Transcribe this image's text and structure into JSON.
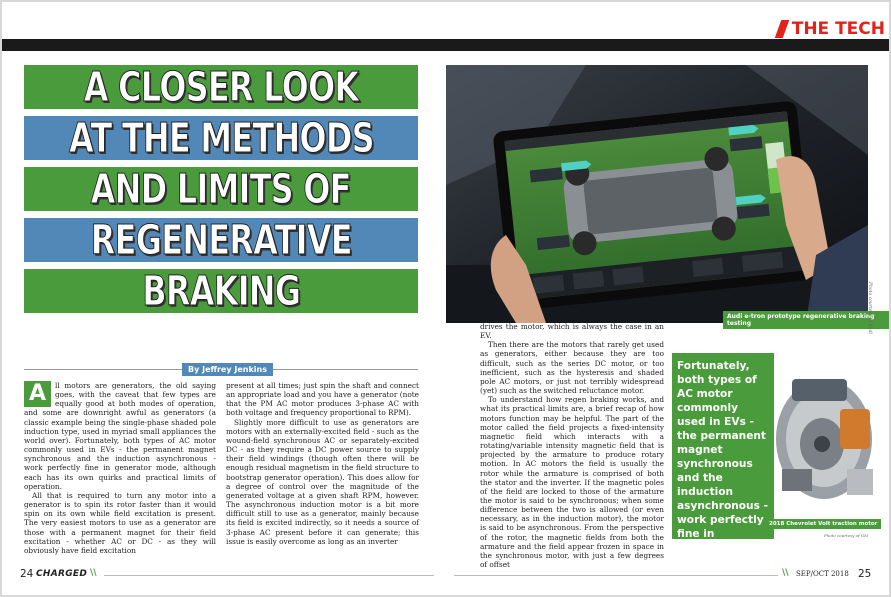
{
  "header": {
    "section": "THE TECH"
  },
  "title_lines": [
    "A CLOSER LOOK",
    "AT THE METHODS",
    "AND LIMITS OF",
    "REGENERATIVE",
    "BRAKING"
  ],
  "byline": "By Jeffrey Jenkins",
  "dropcap": "A",
  "col1": [
    "ll motors are generators, the old saying goes, with the caveat that few types are equally good at both modes of operation, and some are downright awful as generators (a classic example being the single-phase shaded pole induction type, used in myriad small appliances the world over). Fortunately, both types of AC motor commonly used in EVs - the permanent magnet synchronous and the induction asynchronous - work perfectly fine in generator mode, although each has its own quirks and practical limits of operation.",
    "All that is required to turn any motor into a generator is to spin its rotor faster than it would spin on its own while field excitation is present. The very easiest motors to use as a generator are those with a permanent magnet for their field excitation - whether AC or DC - as they will obviously have field excitation"
  ],
  "col2": [
    "present at all times; just spin the shaft and connect an appropriate load and you have a generator (note that the PM AC motor produces 3-phase AC with both voltage and frequency proportional to RPM).",
    "Slightly more difficult to use as generators are motors with an externally-excited field - such as the wound-field synchronous AC or separately-excited DC - as they require a DC power source to supply their field windings (though often there will be enough residual magnetism in the field structure to bootstrap generator operation). This does allow for a degree of control over the magnitude of the generated voltage at a given shaft RPM, however. The asynchronous induction motor is a bit more difficult still to use as a generator, mainly because its field is excited indirectly, so it needs a source of 3-phase AC present before it can generate; this issue is easily overcome as long as an inverter"
  ],
  "col3": [
    "drives the motor, which is always the case in an EV.",
    "Then there are the motors that rarely get used as generators, either because they are too difficult, such as the series DC motor, or too inefficient, such as the hysteresis and shaded pole AC motors, or just not terribly widespread (yet) such as the switched reluctance motor.",
    "To understand how regen braking works, and what its practical limits are, a brief recap of how motors function may be helpful. The part of the motor called the field projects a fixed-intensity magnetic field which interacts with a rotating/variable intensity magnetic field that is projected by the armature to produce rotary motion. In AC motors the field is usually the rotor while the armature is comprised of both the stator and the inverter. If the magnetic poles of the field are locked to those of the armature the motor is said to be synchronous; when some difference between the two is allowed (or even necessary, as in the induction motor), the motor is said to be asynchronous. From the perspective of the rotor, the magnetic fields from both the armature and the field appear frozen in space in the synchronous motor, with just a few degrees of offset"
  ],
  "photo_caption": "Audi e-tron prototype regenerative braking testing",
  "photo_credit": "Photo courtesy of Audi",
  "pullquote": "Fortunately, both types of AC motor commonly used in EVs - the permanent magnet synchronous and the induction asynchronous - work perfectly fine in generator mode.",
  "motor_caption": "2018 Chevrolet Volt traction motor",
  "motor_credit": "Photo courtesy of GM",
  "footer": {
    "page_left": "24",
    "magazine": "CHARGED",
    "date": "SEP/OCT 2018",
    "page_right": "25"
  },
  "colors": {
    "green": "#4a9b3b",
    "blue": "#5188b8",
    "red": "#e2231a"
  }
}
